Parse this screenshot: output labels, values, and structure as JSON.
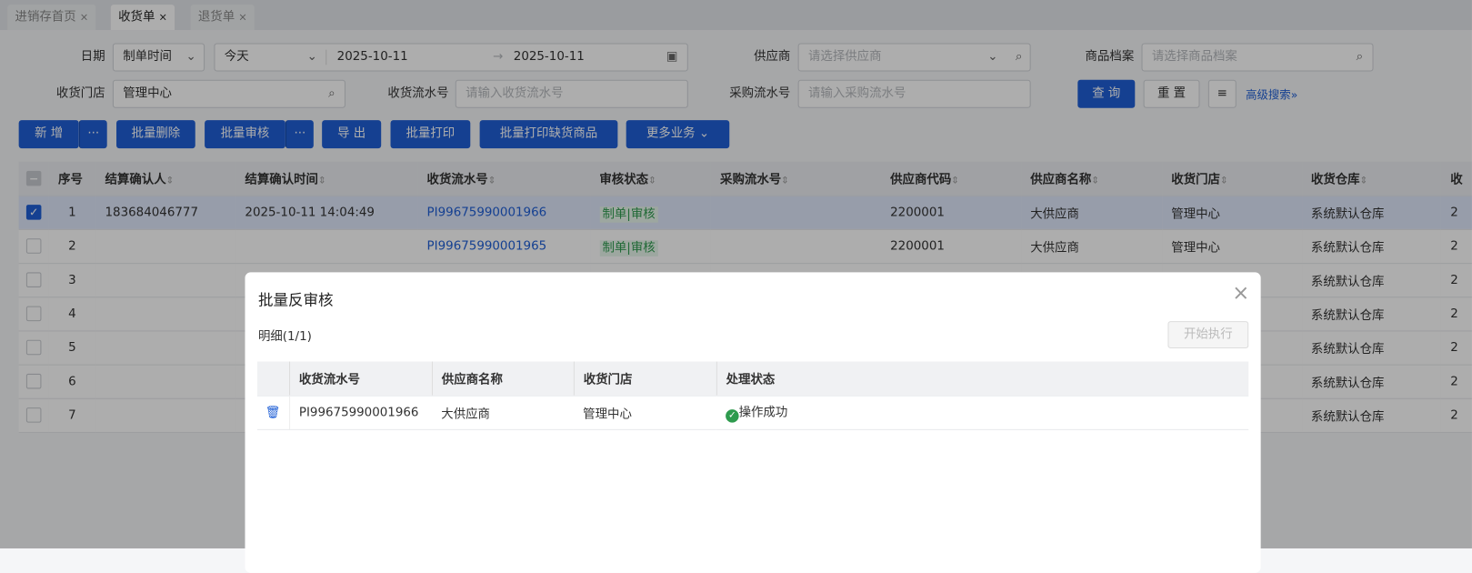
{
  "tabs": [
    {
      "label": "进销存首页",
      "close": "×"
    },
    {
      "label": "收货单",
      "close": "×"
    },
    {
      "label": "退货单",
      "close": "×"
    }
  ],
  "filters": {
    "date_label": "日期",
    "date_type": "制单时间",
    "date_range": "今天",
    "date_from": "2025-10-11",
    "date_to": "2025-10-11",
    "arrow": "→",
    "supplier_label": "供应商",
    "supplier_placeholder": "请选择供应商",
    "product_label": "商品档案",
    "product_placeholder": "请选择商品档案",
    "store_label": "收货门店",
    "store_value": "管理中心",
    "receipt_no_label": "收货流水号",
    "receipt_no_placeholder": "请输入收货流水号",
    "purchase_no_label": "采购流水号",
    "purchase_no_placeholder": "请输入采购流水号",
    "query": "查 询",
    "reset": "重 置",
    "advanced": "高级搜索"
  },
  "toolbar": {
    "add": "新 增",
    "more": "···",
    "batch_delete": "批量删除",
    "batch_audit": "批量审核",
    "export": "导 出",
    "batch_print": "批量打印",
    "batch_print_short": "批量打印缺货商品",
    "more_business": "更多业务"
  },
  "table": {
    "columns": [
      "序号",
      "结算确认人",
      "结算确认时间",
      "收货流水号",
      "审核状态",
      "采购流水号",
      "供应商代码",
      "供应商名称",
      "收货门店",
      "收货仓库",
      "收"
    ],
    "rows": [
      {
        "no": "1",
        "confirmer": "183684046777",
        "time": "2025-10-11 14:04:49",
        "receipt": "PI99675990001966",
        "status": "制单|审核",
        "purchase": "",
        "code": "2200001",
        "supplier": "大供应商",
        "store": "管理中心",
        "warehouse": "系统默认仓库",
        "extra": "2"
      },
      {
        "no": "2",
        "confirmer": "",
        "time": "",
        "receipt": "PI99675990001965",
        "status": "制单|审核",
        "purchase": "",
        "code": "2200001",
        "supplier": "大供应商",
        "store": "管理中心",
        "warehouse": "系统默认仓库",
        "extra": "2"
      },
      {
        "no": "3",
        "warehouse": "系统默认仓库",
        "extra": "2"
      },
      {
        "no": "4",
        "warehouse": "系统默认仓库",
        "extra": "2"
      },
      {
        "no": "5",
        "warehouse": "系统默认仓库",
        "extra": "2"
      },
      {
        "no": "6",
        "warehouse": "系统默认仓库",
        "extra": "2"
      },
      {
        "no": "7",
        "warehouse": "系统默认仓库",
        "extra": "2"
      }
    ]
  },
  "modal": {
    "title": "批量反审核",
    "close": "×",
    "detail": "明细(1/1)",
    "start": "开始执行",
    "columns": [
      "收货流水号",
      "供应商名称",
      "收货门店",
      "处理状态"
    ],
    "rows": [
      {
        "receipt": "PI99675990001966",
        "supplier": "大供应商",
        "store": "管理中心",
        "status": "操作成功"
      }
    ]
  },
  "colors": {
    "primary": "#1f5fd6",
    "success": "#2e9b4e"
  }
}
